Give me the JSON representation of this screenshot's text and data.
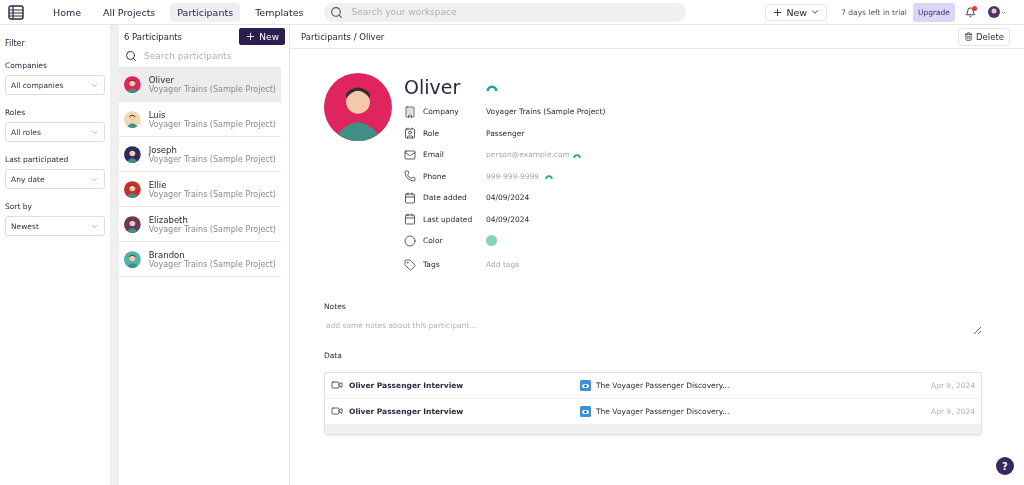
{
  "nav": {
    "tabs": [
      {
        "label": "Home",
        "selected": false
      },
      {
        "label": "All Projects",
        "selected": false
      },
      {
        "label": "Participants",
        "selected": true
      },
      {
        "label": "Templates",
        "selected": false
      }
    ],
    "search": {
      "placeholder": "Search your workspace"
    },
    "new_button": "New",
    "trial": "7 days left in trial",
    "upgrade": "Upgrade",
    "notifications_unread": true
  },
  "filter": {
    "title": "Filter",
    "groups": [
      {
        "label": "Companies",
        "value": "All companies"
      },
      {
        "label": "Roles",
        "value": "All roles"
      },
      {
        "label": "Last participated",
        "value": "Any date"
      },
      {
        "label": "Sort by",
        "value": "Newest"
      }
    ]
  },
  "list": {
    "count": "6 Participants",
    "new_button": "New",
    "search": {
      "placeholder": "Search participants"
    },
    "items": [
      {
        "name": "Oliver",
        "project": "Voyager Trains (Sample Project)",
        "selected": true,
        "color": "#e0245e"
      },
      {
        "name": "Luis",
        "project": "Voyager Trains (Sample Project)",
        "selected": false,
        "color": "#f3d9b1"
      },
      {
        "name": "Joseph",
        "project": "Voyager Trains (Sample Project)",
        "selected": false,
        "color": "#2e2a5e"
      },
      {
        "name": "Ellie",
        "project": "Voyager Trains (Sample Project)",
        "selected": false,
        "color": "#c9302c"
      },
      {
        "name": "Elizabeth",
        "project": "Voyager Trains (Sample Project)",
        "selected": false,
        "color": "#6b3a5a"
      },
      {
        "name": "Brandon",
        "project": "Voyager Trains (Sample Project)",
        "selected": false,
        "color": "#4fb3a9"
      }
    ]
  },
  "detail": {
    "breadcrumb": "Participants / Oliver",
    "delete_button": "Delete",
    "name": "Oliver",
    "fields": [
      {
        "kind": "text",
        "label": "Company",
        "value": "Voyager Trains (Sample Project)",
        "linked": false
      },
      {
        "kind": "text",
        "label": "Role",
        "value": "Passenger",
        "linked": false
      },
      {
        "kind": "hint",
        "label": "Email",
        "placeholder": "person@example.com",
        "linked": true
      },
      {
        "kind": "hint",
        "label": "Phone",
        "placeholder": "999-999-9999",
        "linked": true
      },
      {
        "kind": "text",
        "label": "Date added",
        "value": "04/09/2024",
        "linked": false
      },
      {
        "kind": "text",
        "label": "Last updated",
        "value": "04/09/2024",
        "linked": false
      },
      {
        "kind": "color",
        "label": "Color",
        "color": "#86d1c1",
        "linked": false
      },
      {
        "kind": "hint",
        "label": "Tags",
        "placeholder": "Add tags",
        "linked": false
      }
    ],
    "notes": {
      "label": "Notes",
      "placeholder": "add some notes about this participant..."
    },
    "data": {
      "label": "Data",
      "rows": [
        {
          "title": "Oliver Passenger Interview",
          "project": "The Voyager Passenger Discovery...",
          "date": "Apr 9, 2024"
        },
        {
          "title": "Oliver Passenger Interview",
          "project": "The Voyager Passenger Discovery...",
          "date": "Apr 9, 2024"
        }
      ]
    },
    "help": "?"
  }
}
